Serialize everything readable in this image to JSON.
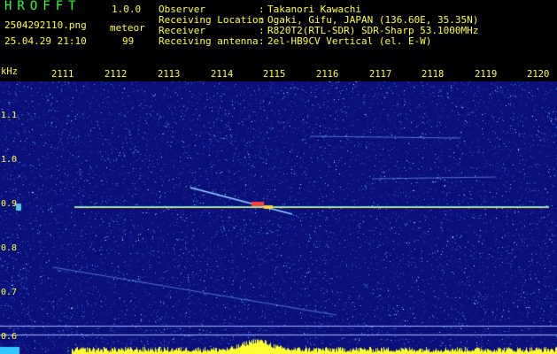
{
  "header": {
    "logo": "HROFFT",
    "version": "1.0.0",
    "filename": "2504292110.png",
    "datetime": "25.04.29 21:10",
    "meteor_label": "meteor",
    "meteor_count": "99",
    "info": [
      {
        "label": "Observer",
        "value": "Takanori Kawachi"
      },
      {
        "label": "Receiving Location",
        "value": "Ogaki, Gifu, JAPAN (136.60E, 35.35N)"
      },
      {
        "label": "Receiver",
        "value": "R820T2(RTL-SDR) SDR-Sharp 53.1000MHz"
      },
      {
        "label": "Receiving antenna",
        "value": "2el-HB9CV Vertical (el. E-W)"
      }
    ]
  },
  "axis": {
    "unit": "kHz",
    "x_ticks": [
      "2111",
      "2112",
      "2113",
      "2114",
      "2115",
      "2116",
      "2117",
      "2118",
      "2119",
      "2120"
    ],
    "y_ticks": [
      "1.1",
      "1.0",
      "0.9",
      "0.8",
      "0.7",
      "0.6"
    ]
  },
  "colors": {
    "background": "#0a0f7a",
    "label": "#ffff33",
    "title": "#33ff33",
    "carrier": "#4ee7c8"
  }
}
